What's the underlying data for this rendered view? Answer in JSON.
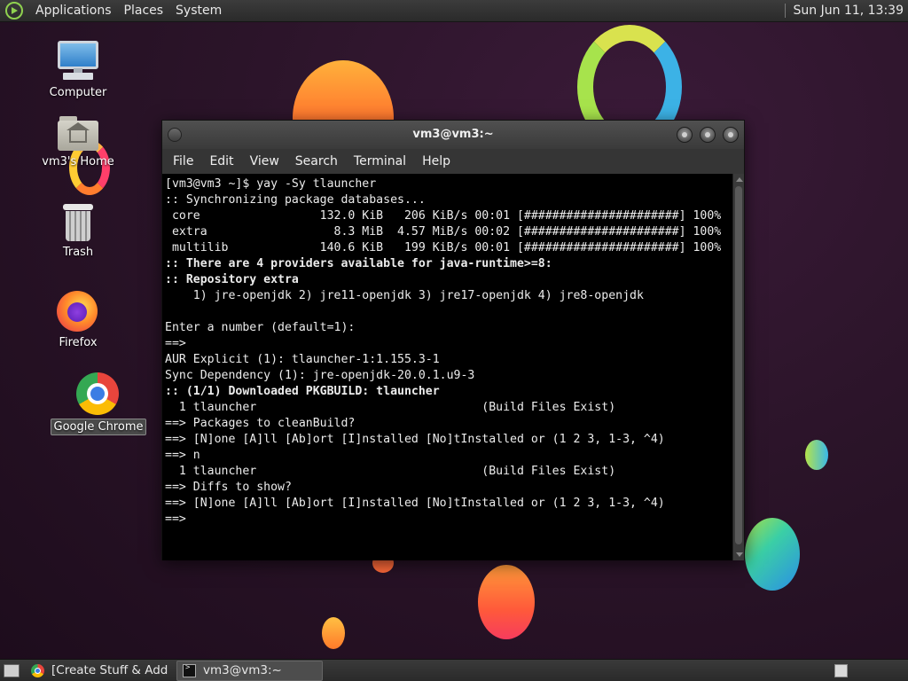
{
  "top_panel": {
    "menus": [
      "Applications",
      "Places",
      "System"
    ],
    "clock": "Sun Jun 11, 13:39"
  },
  "desktop_icons": [
    {
      "label": "Computer",
      "icon": "computer-icon"
    },
    {
      "label": "vm3's Home",
      "icon": "home-folder-icon"
    },
    {
      "label": "Trash",
      "icon": "trash-icon"
    },
    {
      "label": "Firefox",
      "icon": "firefox-icon"
    },
    {
      "label": "Google Chrome",
      "icon": "chrome-icon",
      "selected": true
    }
  ],
  "terminal": {
    "title": "vm3@vm3:~",
    "menu": [
      "File",
      "Edit",
      "View",
      "Search",
      "Terminal",
      "Help"
    ],
    "lines": [
      {
        "text": "[vm3@vm3 ~]$ yay -Sy tlauncher",
        "bold": false
      },
      {
        "text": ":: Synchronizing package databases...",
        "bold": false
      },
      {
        "text": " core                 132.0 KiB   206 KiB/s 00:01 [######################] 100%",
        "bold": false
      },
      {
        "text": " extra                  8.3 MiB  4.57 MiB/s 00:02 [######################] 100%",
        "bold": false
      },
      {
        "text": " multilib             140.6 KiB   199 KiB/s 00:01 [######################] 100%",
        "bold": false
      },
      {
        "text": ":: There are 4 providers available for java-runtime>=8:",
        "bold": true
      },
      {
        "text": ":: Repository extra",
        "bold": true
      },
      {
        "text": "    1) jre-openjdk 2) jre11-openjdk 3) jre17-openjdk 4) jre8-openjdk",
        "bold": false
      },
      {
        "text": "",
        "bold": false
      },
      {
        "text": "Enter a number (default=1):",
        "bold": false
      },
      {
        "text": "==>",
        "bold": false
      },
      {
        "text": "AUR Explicit (1): tlauncher-1:1.155.3-1",
        "bold": false
      },
      {
        "text": "Sync Dependency (1): jre-openjdk-20.0.1.u9-3",
        "bold": false
      },
      {
        "text": ":: (1/1) Downloaded PKGBUILD: tlauncher",
        "bold": true
      },
      {
        "text": "  1 tlauncher                                (Build Files Exist)",
        "bold": false
      },
      {
        "text": "==> Packages to cleanBuild?",
        "bold": false
      },
      {
        "text": "==> [N]one [A]ll [Ab]ort [I]nstalled [No]tInstalled or (1 2 3, 1-3, ^4)",
        "bold": false
      },
      {
        "text": "==> n",
        "bold": false
      },
      {
        "text": "  1 tlauncher                                (Build Files Exist)",
        "bold": false
      },
      {
        "text": "==> Diffs to show?",
        "bold": false
      },
      {
        "text": "==> [N]one [A]ll [Ab]ort [I]nstalled [No]tInstalled or (1 2 3, 1-3, ^4)",
        "bold": false
      },
      {
        "text": "==>",
        "bold": false
      }
    ]
  },
  "taskbar": {
    "tasks": [
      {
        "label": "[Create Stuff & Addi...",
        "icon": "chrome-icon",
        "active": false
      },
      {
        "label": "vm3@vm3:~",
        "icon": "terminal-icon",
        "active": true
      }
    ]
  }
}
